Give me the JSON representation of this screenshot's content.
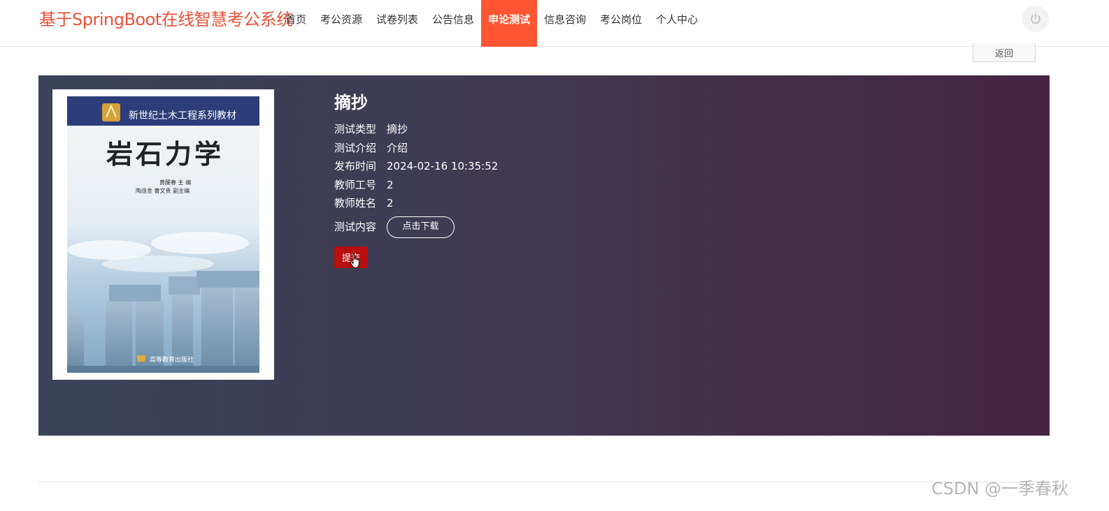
{
  "header": {
    "site_title": "基于SpringBoot在线智慧考公系统",
    "nav": [
      {
        "label": "首页"
      },
      {
        "label": "考公资源"
      },
      {
        "label": "试卷列表"
      },
      {
        "label": "公告信息"
      },
      {
        "label": "申论测试"
      },
      {
        "label": "信息咨询"
      },
      {
        "label": "考公岗位"
      },
      {
        "label": "个人中心"
      }
    ],
    "active_nav": "申论测试",
    "power_icon": "power-icon"
  },
  "back_label": "返回",
  "detail": {
    "title": "摘抄",
    "fields": [
      {
        "label": "测试类型",
        "value": "摘抄"
      },
      {
        "label": "测试介绍",
        "value": "介绍"
      },
      {
        "label": "发布时间",
        "value": "2024-02-16 10:35:52"
      },
      {
        "label": "教师工号",
        "value": "2"
      },
      {
        "label": "教师姓名",
        "value": "2"
      }
    ],
    "content_label": "测试内容",
    "download_label": "点击下载",
    "submit_label": "提交"
  },
  "cover": {
    "series": "新世纪土木工程系列教材",
    "book_title": "岩石力学",
    "editors_line1": "黄醒春  主 编",
    "editors_line2": "陶连金  曹文贵  副主编",
    "publisher": "高等教育出版社"
  },
  "watermark": "CSDN @一季春秋",
  "colors": {
    "accent": "#ff5533",
    "title": "#e8523a",
    "submit": "#b80f0f"
  }
}
